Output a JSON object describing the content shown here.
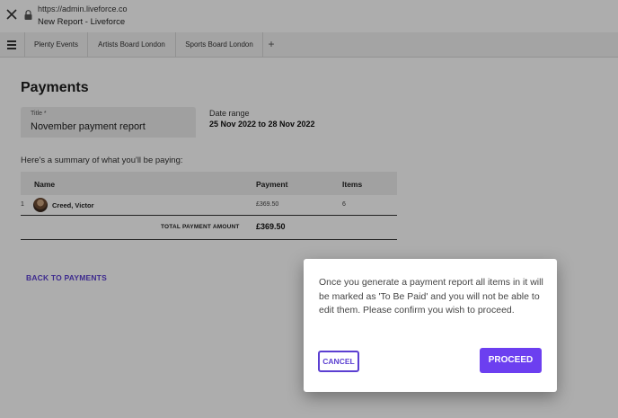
{
  "browser": {
    "url": "https://admin.liveforce.co",
    "page_title": "New Report - Liveforce"
  },
  "tabs": [
    {
      "label": "Plenty Events"
    },
    {
      "label": "Artists Board London"
    },
    {
      "label": "Sports Board London"
    }
  ],
  "tab_add_label": "+",
  "page": {
    "heading": "Payments",
    "title_field": {
      "label": "Title *",
      "value": "November payment report"
    },
    "date_range": {
      "label": "Date range",
      "value": "25 Nov 2022 to 28 Nov 2022"
    },
    "summary_text": "Here's a summary of what you'll be paying:",
    "table": {
      "columns": [
        "Name",
        "Payment",
        "Items"
      ],
      "rows": [
        {
          "index": "1",
          "name": "Creed, Victor",
          "payment": "£369.50",
          "items": "6"
        }
      ],
      "total_label": "TOTAL PAYMENT AMOUNT",
      "total_value": "£369.50"
    },
    "back_link": "BACK TO PAYMENTS"
  },
  "dialog": {
    "message": "Once you generate a payment report all items in it will be marked as 'To Be Paid' and you will not be able to edit them. Please confirm you wish to proceed.",
    "cancel_label": "CANCEL",
    "proceed_label": "PROCEED"
  },
  "colors": {
    "accent": "#6c3ff0",
    "link": "#5b3fd1",
    "overlay": "rgba(0,0,0,0.32)"
  }
}
